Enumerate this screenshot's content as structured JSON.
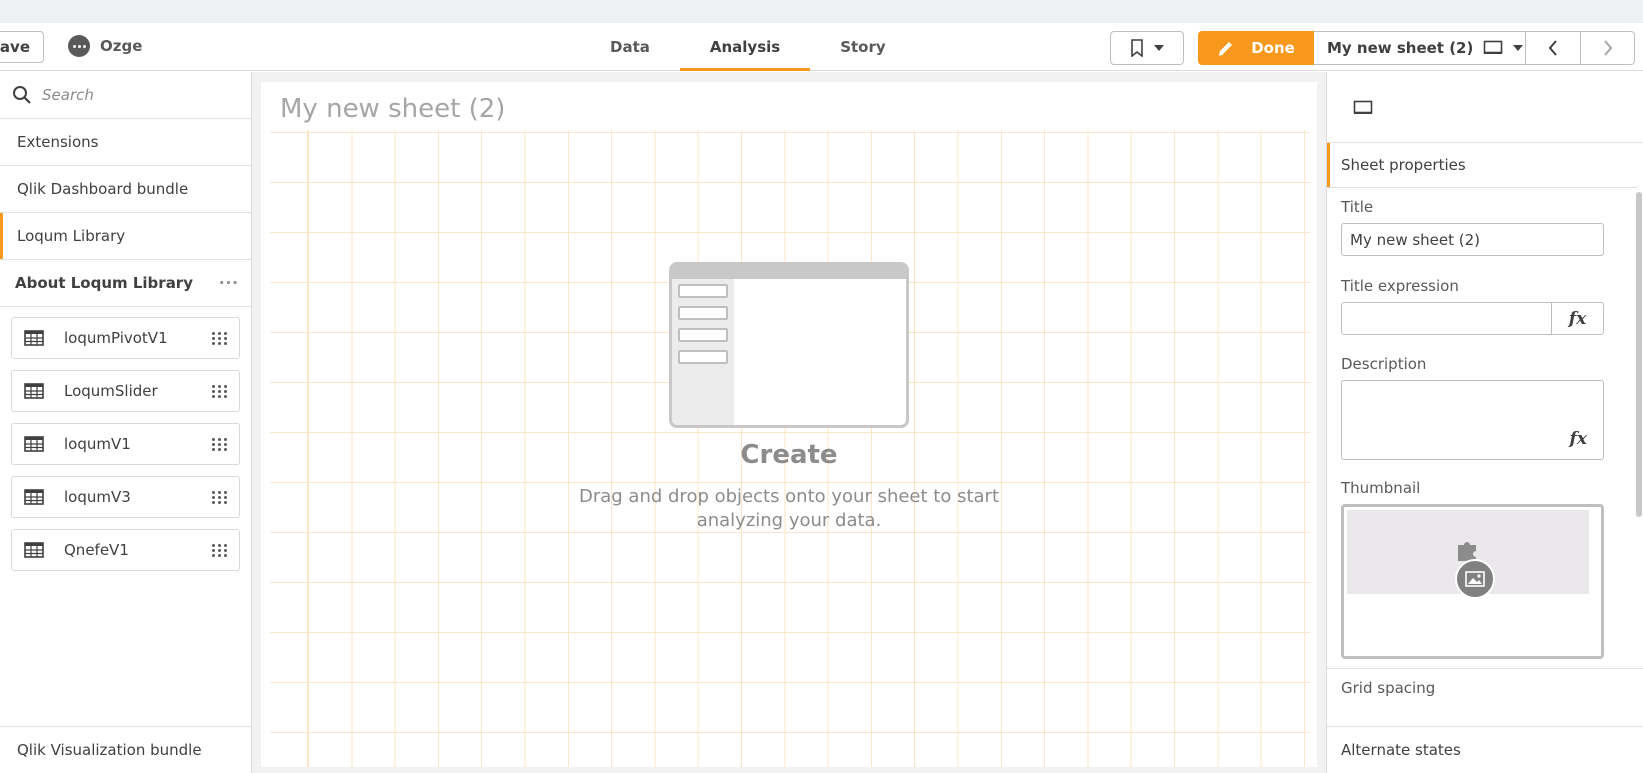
{
  "toolbar": {
    "save_label": "Save",
    "user_name": "Ozge",
    "tabs": [
      {
        "label": "Data"
      },
      {
        "label": "Analysis"
      },
      {
        "label": "Story"
      }
    ],
    "active_tab": "Analysis",
    "done_label": "Done",
    "sheet_name": "My new sheet (2)"
  },
  "left_panel": {
    "search_placeholder": "Search",
    "items": [
      {
        "label": "Extensions"
      },
      {
        "label": "Qlik Dashboard bundle"
      },
      {
        "label": "Loqum Library"
      }
    ],
    "group_title": "About Loqum Library",
    "group_menu": "···",
    "extensions": [
      {
        "name": "loqumPivotV1"
      },
      {
        "name": "LoqumSlider"
      },
      {
        "name": "loqumV1"
      },
      {
        "name": "loqumV3"
      },
      {
        "name": "QnefeV1"
      }
    ],
    "bottom_item": "Qlik Visualization bundle"
  },
  "canvas": {
    "sheet_title": "My new sheet (2)",
    "create_title": "Create",
    "create_desc_line1": "Drag and drop objects onto your sheet to start",
    "create_desc_line2": "analyzing your data."
  },
  "right_panel": {
    "section": "Sheet properties",
    "title_label": "Title",
    "title_value": "My new sheet (2)",
    "title_expr_label": "Title expression",
    "fx": "fx",
    "description_label": "Description",
    "thumbnail_label": "Thumbnail",
    "grid_spacing_label": "Grid spacing",
    "alternate_states_label": "Alternate states"
  },
  "colors": {
    "accent": "#f8981d",
    "grid_line": "#fde3c2"
  }
}
